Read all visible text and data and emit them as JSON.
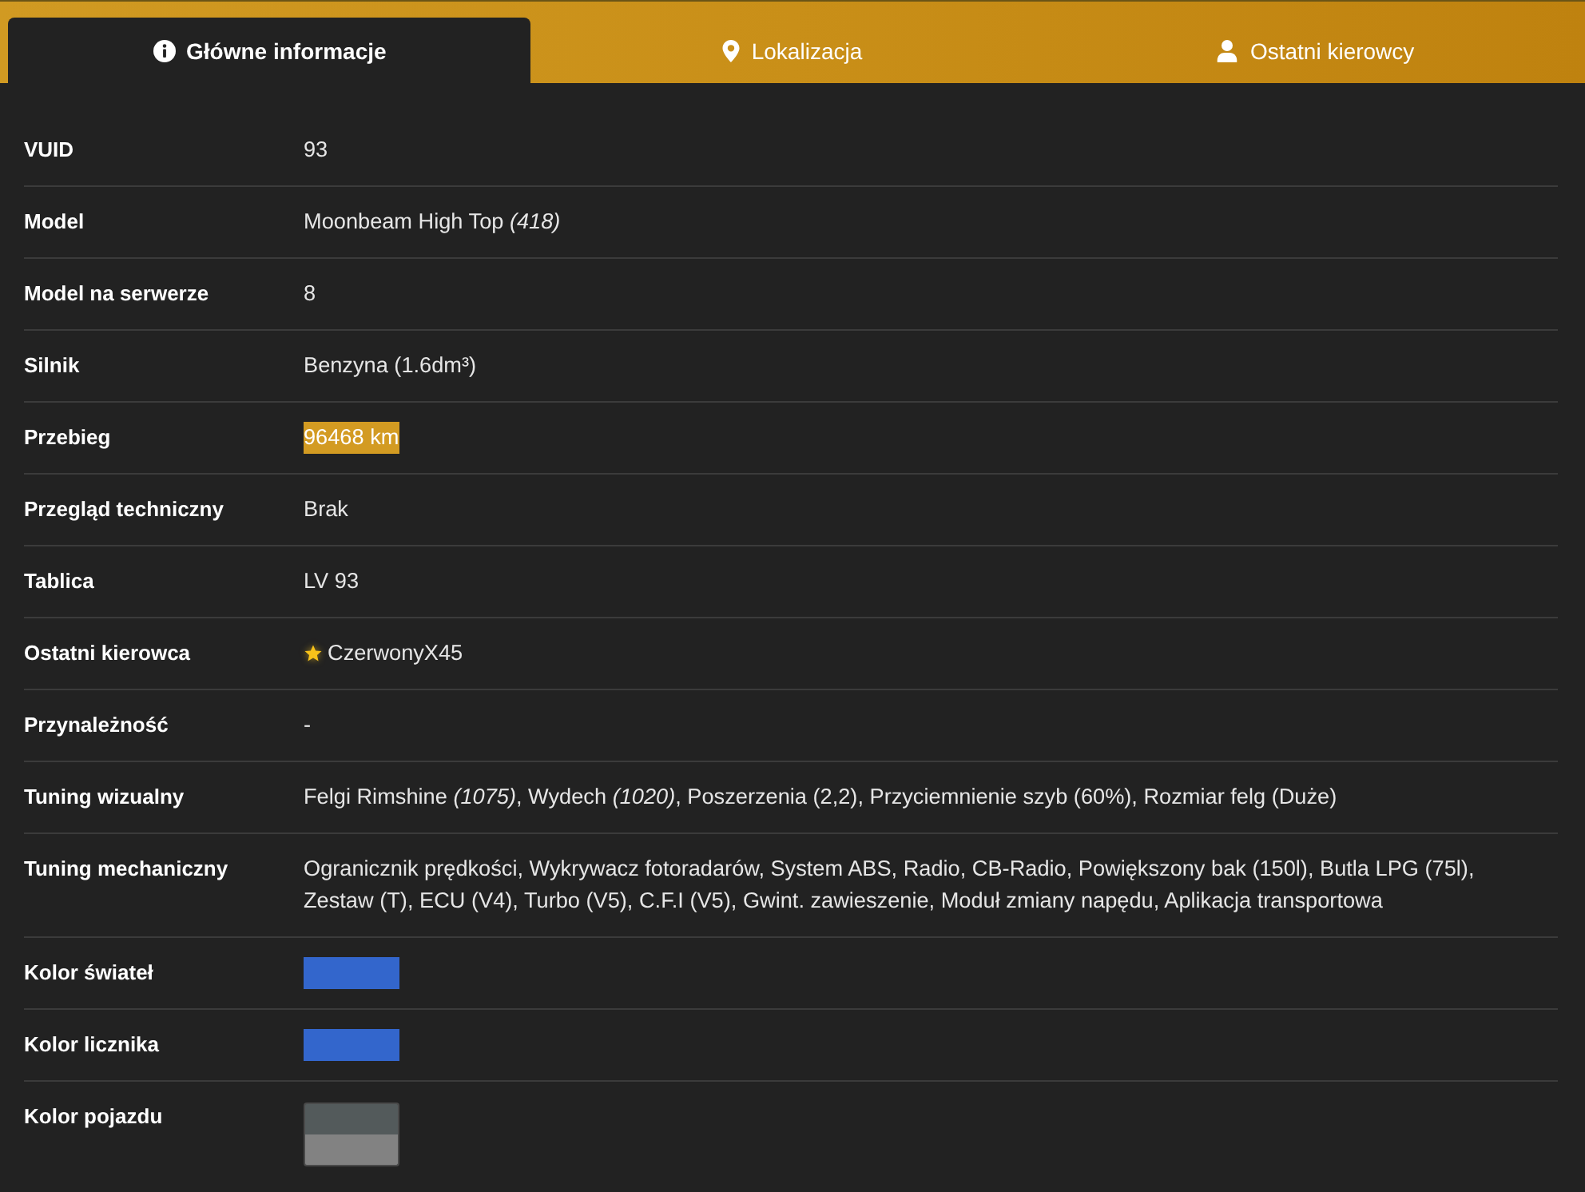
{
  "tabs": [
    {
      "label": "Główne informacje",
      "selected": true
    },
    {
      "label": "Lokalizacja",
      "selected": false
    },
    {
      "label": "Ostatni kierowcy",
      "selected": false
    }
  ],
  "rows": [
    {
      "label": "VUID",
      "kind": "text",
      "value": "93"
    },
    {
      "label": "Model",
      "kind": "text",
      "value": "Moonbeam High Top *(418)*"
    },
    {
      "label": "Model na serwerze",
      "kind": "text",
      "value": "8"
    },
    {
      "label": "Silnik",
      "kind": "text",
      "value": "Benzyna (1.6dm³)"
    },
    {
      "label": "Przebieg",
      "kind": "highlight",
      "value": "96468 km"
    },
    {
      "label": "Przegląd techniczny",
      "kind": "text",
      "value": "Brak"
    },
    {
      "label": "Tablica",
      "kind": "text",
      "value": "LV 93"
    },
    {
      "label": "Ostatni kierowca",
      "kind": "starred",
      "value": "CzerwonyX45"
    },
    {
      "label": "Przynależność",
      "kind": "text",
      "value": "-"
    },
    {
      "label": "Tuning wizualny",
      "kind": "text",
      "value": "Felgi Rimshine *(1075)*, Wydech *(1020)*, Poszerzenia (2,2), Przyciemnienie szyb (60%), Rozmiar felg (Duże)"
    },
    {
      "label": "Tuning mechaniczny",
      "kind": "text",
      "value": "Ogranicznik prędkości, Wykrywacz fotoradarów, System ABS, Radio, CB-Radio, Powiększony bak (150l), Butla LPG (75l), Zestaw (T), ECU (V4), Turbo (V5), C.F.I (V5), Gwint. zawieszenie, Moduł zmiany napędu, Aplikacja transportowa"
    },
    {
      "label": "Kolor świateł",
      "kind": "color",
      "color": "#3366cc"
    },
    {
      "label": "Kolor licznika",
      "kind": "color",
      "color": "#3366cc"
    },
    {
      "label": "Kolor pojazdu",
      "kind": "two_colors",
      "swatches": [
        {
          "color": "#535a5b"
        },
        {
          "color": "#828282"
        }
      ]
    }
  ]
}
